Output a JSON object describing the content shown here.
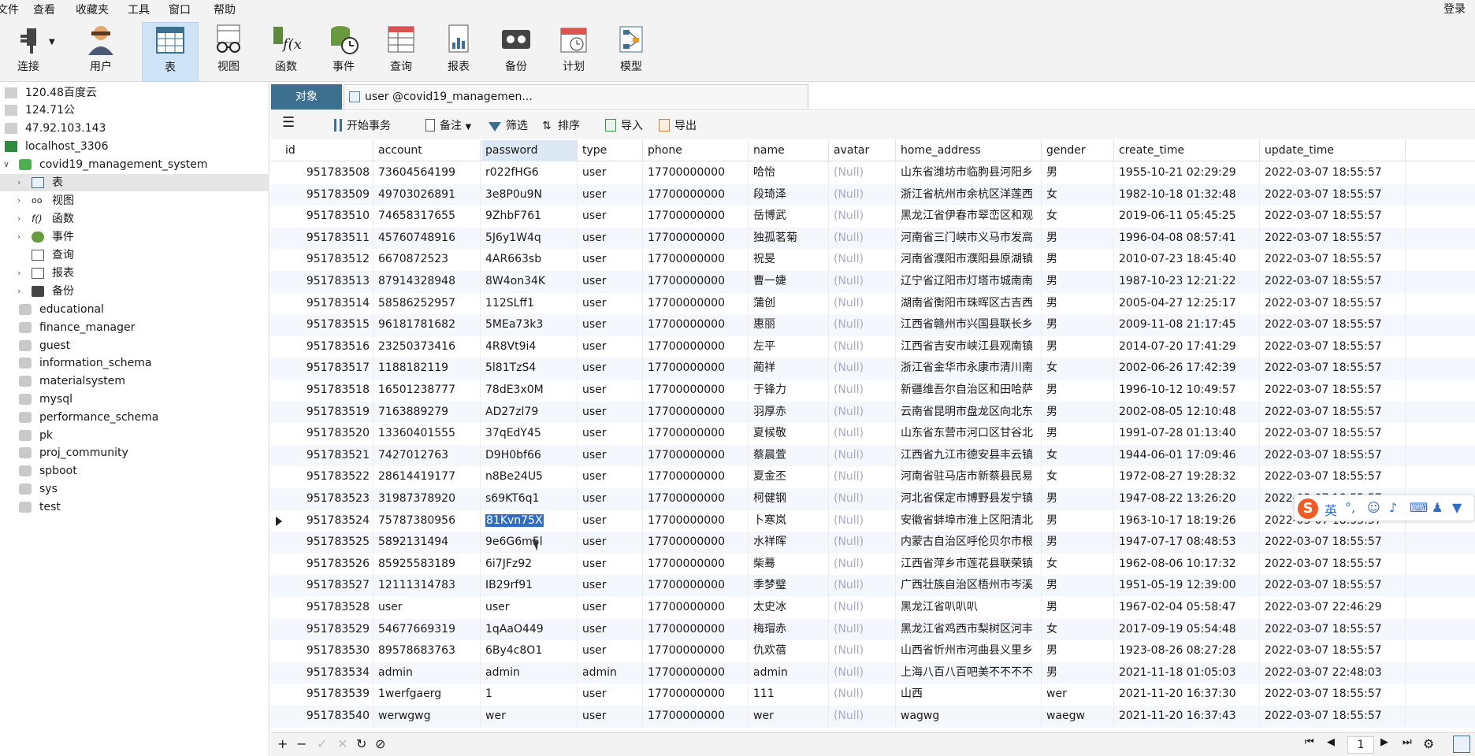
{
  "menu": {
    "items": [
      "文件",
      "查看",
      "收藏夹",
      "工具",
      "窗口",
      "帮助"
    ],
    "login": "登录"
  },
  "toolbar": {
    "connect": "连接",
    "user": "用户",
    "table": "表",
    "view": "视图",
    "function": "函数",
    "event": "事件",
    "query": "查询",
    "report": "报表",
    "backup": "备份",
    "schedule": "计划",
    "model": "模型"
  },
  "sidebar": {
    "connections": [
      "120.48百度云",
      "124.71公",
      "47.92.103.143",
      "localhost_3306"
    ],
    "database": "covid19_management_system",
    "objects": [
      "表",
      "视图",
      "函数",
      "事件",
      "查询",
      "报表",
      "备份"
    ],
    "other_dbs": [
      "educational",
      "finance_manager",
      "guest",
      "information_schema",
      "materialsystem",
      "mysql",
      "performance_schema",
      "pk",
      "proj_community",
      "spboot",
      "sys",
      "test"
    ]
  },
  "tabs": {
    "objects": "对象",
    "current": "user @covid19_managemen..."
  },
  "subtoolbar": {
    "begin_tx": "开始事务",
    "memo": "备注",
    "filter": "筛选",
    "sort": "排序",
    "import": "导入",
    "export": "导出"
  },
  "table": {
    "columns": [
      "id",
      "account",
      "password",
      "type",
      "phone",
      "name",
      "avatar",
      "home_address",
      "gender",
      "create_time",
      "update_time"
    ],
    "rows": [
      [
        "951783508",
        "73604564199",
        "r022fHG6",
        "user",
        "17700000000",
        "哈怡",
        "(Null)",
        "山东省潍坊市临朐县河阳乡",
        "男",
        "1955-10-21 02:29:29",
        "2022-03-07 18:55:57"
      ],
      [
        "951783509",
        "49703026891",
        "3e8P0u9N",
        "user",
        "17700000000",
        "段琦泽",
        "(Null)",
        "浙江省杭州市余杭区洋莲西",
        "女",
        "1982-10-18 01:32:48",
        "2022-03-07 18:55:57"
      ],
      [
        "951783510",
        "74658317655",
        "9ZhbF761",
        "user",
        "17700000000",
        "岳博武",
        "(Null)",
        "黑龙江省伊春市翠峦区和观",
        "女",
        "2019-06-11 05:45:25",
        "2022-03-07 18:55:57"
      ],
      [
        "951783511",
        "45760748916",
        "5J6y1W4q",
        "user",
        "17700000000",
        "独孤茗菊",
        "(Null)",
        "河南省三门峡市义马市发高",
        "男",
        "1996-04-08 08:57:41",
        "2022-03-07 18:55:57"
      ],
      [
        "951783512",
        "6670872523",
        "4AR663sb",
        "user",
        "17700000000",
        "祝旻",
        "(Null)",
        "河南省濮阳市濮阳县原湖镇",
        "男",
        "2010-07-23 18:45:40",
        "2022-03-07 18:55:57"
      ],
      [
        "951783513",
        "87914328948",
        "8W4on34K",
        "user",
        "17700000000",
        "曹一婕",
        "(Null)",
        "辽宁省辽阳市灯塔市城南南",
        "男",
        "1987-10-23 12:21:22",
        "2022-03-07 18:55:57"
      ],
      [
        "951783514",
        "58586252957",
        "112SLff1",
        "user",
        "17700000000",
        "蒲创",
        "(Null)",
        "湖南省衡阳市珠晖区古吉西",
        "男",
        "2005-04-27 12:25:17",
        "2022-03-07 18:55:57"
      ],
      [
        "951783515",
        "96181781682",
        "5MEa73k3",
        "user",
        "17700000000",
        "惠丽",
        "(Null)",
        "江西省赣州市兴国县联长乡",
        "男",
        "2009-11-08 21:17:45",
        "2022-03-07 18:55:57"
      ],
      [
        "951783516",
        "23250373416",
        "4R8Vt9i4",
        "user",
        "17700000000",
        "左平",
        "(Null)",
        "江西省吉安市峡江县观南镇",
        "男",
        "2014-07-20 17:41:29",
        "2022-03-07 18:55:57"
      ],
      [
        "951783517",
        "1188182119",
        "5l81TzS4",
        "user",
        "17700000000",
        "蔺祥",
        "(Null)",
        "浙江省金华市永康市清川南",
        "女",
        "2002-06-26 17:42:39",
        "2022-03-07 18:55:57"
      ],
      [
        "951783518",
        "16501238777",
        "78dE3x0M",
        "user",
        "17700000000",
        "于锋力",
        "(Null)",
        "新疆维吾尔自治区和田哈萨",
        "男",
        "1996-10-12 10:49:57",
        "2022-03-07 18:55:57"
      ],
      [
        "951783519",
        "7163889279",
        "AD27zl79",
        "user",
        "17700000000",
        "羽厚赤",
        "(Null)",
        "云南省昆明市盘龙区向北东",
        "男",
        "2002-08-05 12:10:48",
        "2022-03-07 18:55:57"
      ],
      [
        "951783520",
        "13360401555",
        "37qEdY45",
        "user",
        "17700000000",
        "夏候敬",
        "(Null)",
        "山东省东营市河口区甘谷北",
        "男",
        "1991-07-28 01:13:40",
        "2022-03-07 18:55:57"
      ],
      [
        "951783521",
        "7427012763",
        "D9H0bf66",
        "user",
        "17700000000",
        "蔡晨萱",
        "(Null)",
        "江西省九江市德安县丰云镇",
        "女",
        "1944-06-01 17:09:46",
        "2022-03-07 18:55:57"
      ],
      [
        "951783522",
        "28614419177",
        "n8Be24U5",
        "user",
        "17700000000",
        "夏金丕",
        "(Null)",
        "河南省驻马店市新蔡县民易",
        "女",
        "1972-08-27 19:28:32",
        "2022-03-07 18:55:57"
      ],
      [
        "951783523",
        "31987378920",
        "s69KT6q1",
        "user",
        "17700000000",
        "柯健钢",
        "(Null)",
        "河北省保定市博野县发宁镇",
        "男",
        "1947-08-22 13:26:20",
        "2022-03-07 18:55:57"
      ],
      [
        "951783524",
        "75787380956",
        "81Kvn75X",
        "user",
        "17700000000",
        "卜寒岚",
        "(Null)",
        "安徽省蚌埠市淮上区阳清北",
        "男",
        "1963-10-17 18:19:26",
        "2022-03-07 18:55:57"
      ],
      [
        "951783525",
        "5892131494",
        "9e6G6m5l",
        "user",
        "17700000000",
        "水祥晖",
        "(Null)",
        "内蒙古自治区呼伦贝尔市根",
        "男",
        "1947-07-17 08:48:53",
        "2022-03-07 18:55:57"
      ],
      [
        "951783526",
        "85925583189",
        "6i7JFz92",
        "user",
        "17700000000",
        "柴蓦",
        "(Null)",
        "江西省萍乡市莲花县联荣镇",
        "女",
        "1962-08-06 10:17:32",
        "2022-03-07 18:55:57"
      ],
      [
        "951783527",
        "12111314783",
        "IB29rf91",
        "user",
        "17700000000",
        "季梦璧",
        "(Null)",
        "广西壮族自治区梧州市岑溪",
        "男",
        "1951-05-19 12:39:00",
        "2022-03-07 18:55:57"
      ],
      [
        "951783528",
        "user",
        "user",
        "user",
        "17700000000",
        "太史冰",
        "(Null)",
        "黑龙江省叭叭叭",
        "男",
        "1967-02-04 05:58:47",
        "2022-03-07 22:46:29"
      ],
      [
        "951783529",
        "54677669319",
        "1qAaO449",
        "user",
        "17700000000",
        "梅瑁赤",
        "(Null)",
        "黑龙江省鸡西市梨树区河丰",
        "女",
        "2017-09-19 05:54:48",
        "2022-03-07 18:55:57"
      ],
      [
        "951783530",
        "89578683763",
        "6By4c8O1",
        "user",
        "17700000000",
        "仇欢蓓",
        "(Null)",
        "山西省忻州市河曲县义里乡",
        "男",
        "1923-08-26 08:27:28",
        "2022-03-07 18:55:57"
      ],
      [
        "951783534",
        "admin",
        "admin",
        "admin",
        "17700000000",
        "admin",
        "(Null)",
        "上海八百八百吧美不不不不",
        "男",
        "2021-11-18 01:05:03",
        "2022-03-07 22:48:03"
      ],
      [
        "951783539",
        "1werfgaerg",
        "1",
        "user",
        "17700000000",
        "111",
        "(Null)",
        "山西",
        "wer",
        "2021-11-20 16:37:30",
        "2022-03-07 18:55:57"
      ],
      [
        "951783540",
        "werwgwg",
        "wer",
        "user",
        "17700000000",
        "wer",
        "(Null)",
        "wagwg",
        "waegw",
        "2021-11-20 16:37:43",
        "2022-03-07 18:55:57"
      ]
    ],
    "selected_row_index": 16,
    "selected_column": "password"
  },
  "pagination": {
    "page": "1"
  },
  "ime": {
    "lang": "英"
  }
}
